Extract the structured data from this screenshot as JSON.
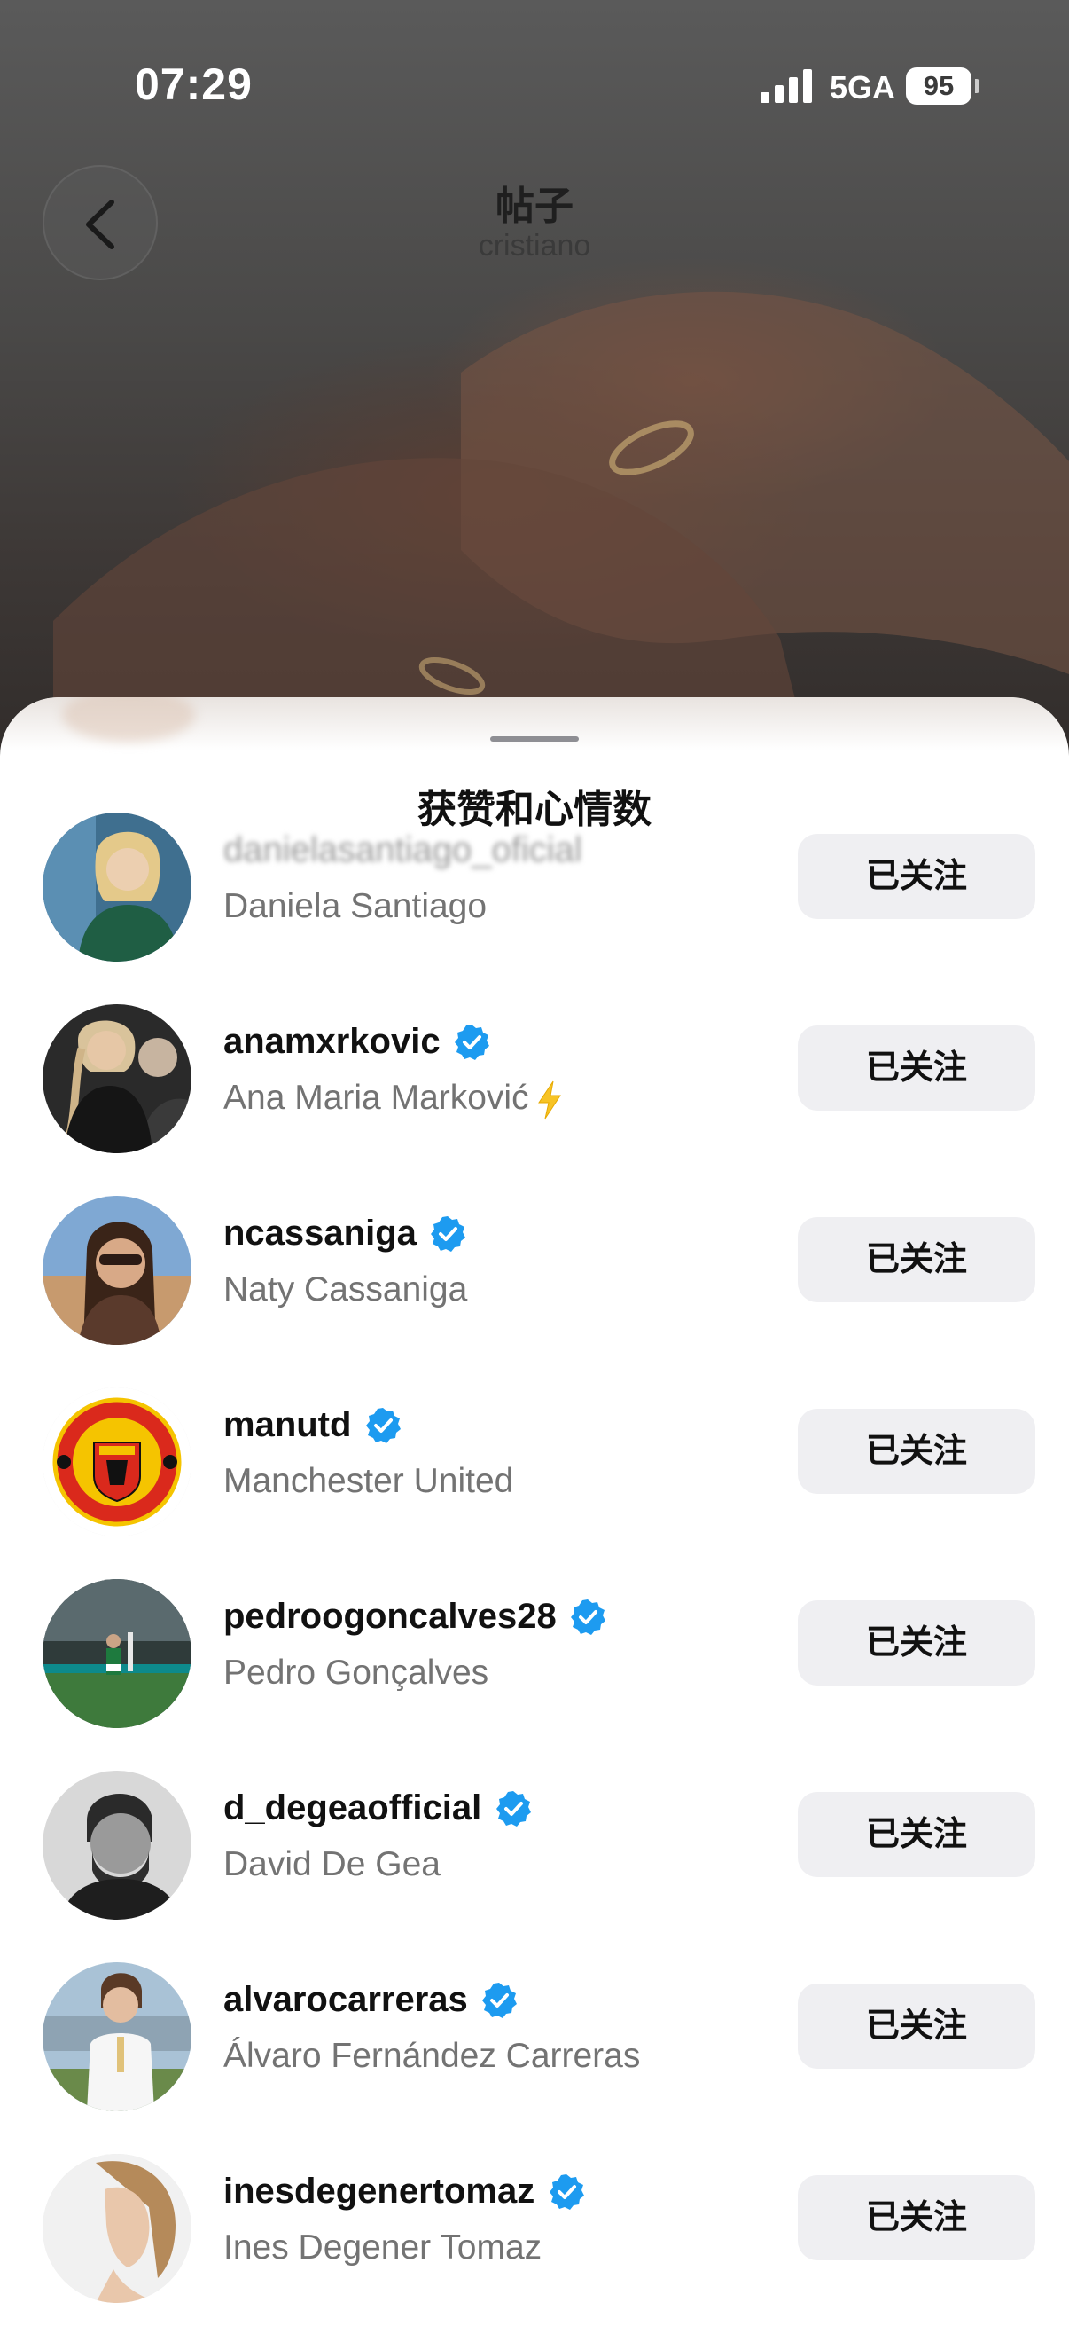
{
  "status_bar": {
    "time": "07:29",
    "network": "5GA",
    "battery": "95"
  },
  "header": {
    "title": "帖子",
    "subtitle": "cristiano"
  },
  "sheet": {
    "title": "获赞和心情数"
  },
  "colors": {
    "verified": "#1d9bf0",
    "follow_button_bg": "#efeff2",
    "secondary_text": "#737373"
  },
  "users": [
    {
      "username": "danielasantiago_oficial",
      "fullname": "Daniela Santiago",
      "verified": false,
      "button": "已关注",
      "avatar": "woman-portrait-blonde"
    },
    {
      "username": "anamxrkovic",
      "fullname": "Ana Maria Marković",
      "verified": true,
      "emoji": "lightning-bolt",
      "button": "已关注",
      "avatar": "woman-braid-dark-shirt"
    },
    {
      "username": "ncassaniga",
      "fullname": "Naty Cassaniga",
      "verified": true,
      "button": "已关注",
      "avatar": "woman-selfie-sunglasses"
    },
    {
      "username": "manutd",
      "fullname": "Manchester United",
      "verified": true,
      "button": "已关注",
      "avatar": "manchester-united-crest"
    },
    {
      "username": "pedroogoncalves28",
      "fullname": "Pedro Gonçalves",
      "verified": true,
      "button": "已关注",
      "avatar": "player-on-pitch"
    },
    {
      "username": "d_degeaofficial",
      "fullname": "David De Gea",
      "verified": true,
      "button": "已关注",
      "avatar": "man-bearded-monochrome"
    },
    {
      "username": "alvarocarreras",
      "fullname": "Álvaro Fernández Carreras",
      "verified": true,
      "button": "已关注",
      "avatar": "player-white-kit"
    },
    {
      "username": "inesdegenertomaz",
      "fullname": "Ines Degener Tomaz",
      "verified": true,
      "button": "已关注",
      "avatar": "woman-profile-light"
    }
  ]
}
